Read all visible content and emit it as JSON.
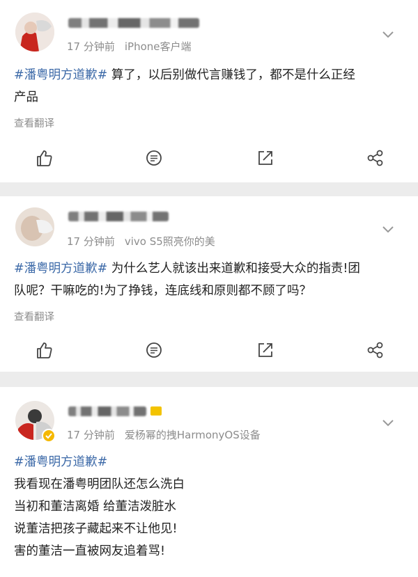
{
  "posts": [
    {
      "time": "17 分钟前",
      "source": "iPhone客户端",
      "hashtag": "#潘粤明方道歉#",
      "lines": [
        "算了，以后别做代言赚钱了，都不是什么正经",
        "产品"
      ],
      "translate": "查看翻译"
    },
    {
      "time": "17 分钟前",
      "source": "vivo S5照亮你的美",
      "hashtag": "#潘粤明方道歉#",
      "lines": [
        "为什么艺人就该出来道歉和接受大众的指责!团",
        "队呢？干嘛吃的!为了挣钱，连底线和原则都不顾了吗？"
      ],
      "translate": "查看翻译"
    },
    {
      "time": "17 分钟前",
      "source": "爱杨幂的拽HarmonyOS设备",
      "hashtag": "#潘粤明方道歉#",
      "lines": [
        "我看现在潘粤明团队还怎么洗白",
        "当初和董洁离婚 给董洁泼脏水",
        "说董洁把孩子藏起来不让他见!",
        "害的董洁一直被网友追着骂!"
      ]
    }
  ],
  "icons": {
    "like": "thumbs-up-icon",
    "comment": "comment-icon",
    "repost": "repost-icon",
    "share": "share-icon",
    "menu": "chevron-down-icon",
    "verified": "verified-badge-icon"
  },
  "colors": {
    "hashtag": "#3d6aa8",
    "meta": "#8c8c8c",
    "separator": "#ececec",
    "badge": "#f5b800"
  }
}
